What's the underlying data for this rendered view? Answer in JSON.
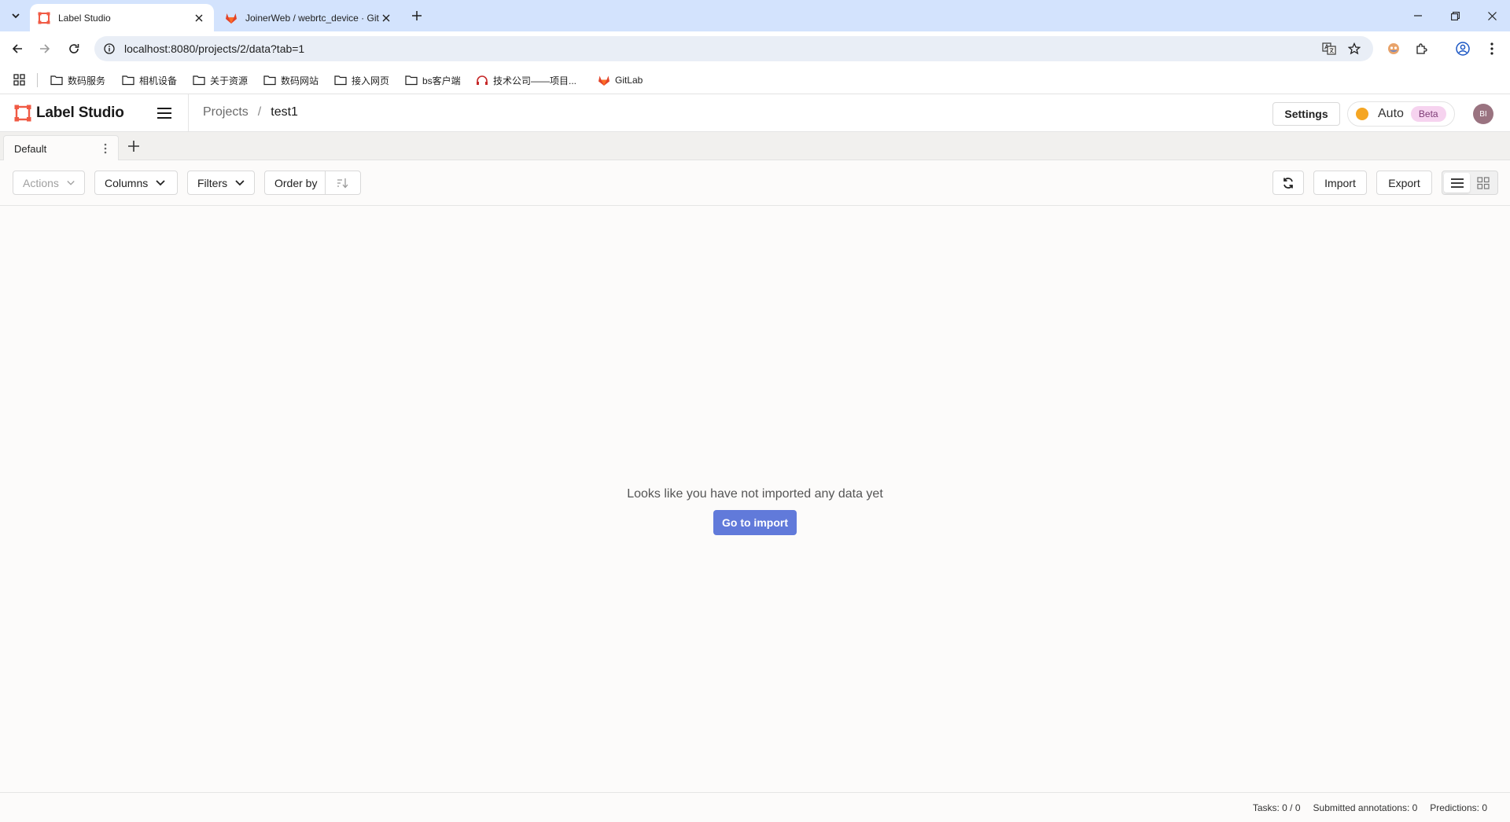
{
  "browser": {
    "tabs": [
      {
        "title": "Label Studio",
        "active": true
      },
      {
        "title": "JoinerWeb / webrtc_device · GitLab",
        "active": false
      }
    ],
    "address": "localhost:8080/projects/2/data?tab=1",
    "bookmarks": [
      "数码服务",
      "相机设备",
      "关于资源",
      "数码网站",
      "接入网页",
      "bs客户端",
      "技术公司——项目...",
      "GitLab"
    ]
  },
  "header": {
    "app_name": "Label Studio",
    "breadcrumb": {
      "projects": "Projects",
      "separator": "/",
      "current": "test1"
    },
    "settings_label": "Settings",
    "auto_label": "Auto",
    "beta_label": "Beta",
    "avatar_initials": "BI"
  },
  "view_tabs": [
    {
      "label": "Default"
    }
  ],
  "toolbar": {
    "actions_label": "Actions",
    "columns_label": "Columns",
    "filters_label": "Filters",
    "order_by_label": "Order by",
    "import_label": "Import",
    "export_label": "Export"
  },
  "empty_state": {
    "message": "Looks like you have not imported any data yet",
    "cta_label": "Go to import"
  },
  "footer": {
    "tasks": "Tasks: 0 / 0",
    "submitted": "Submitted annotations: 0",
    "predictions": "Predictions: 0"
  },
  "colors": {
    "accent": "#617ada",
    "browser_chrome": "#d3e3fd",
    "auto_dot": "#f5a623",
    "beta_bg": "#f6d3ef"
  }
}
